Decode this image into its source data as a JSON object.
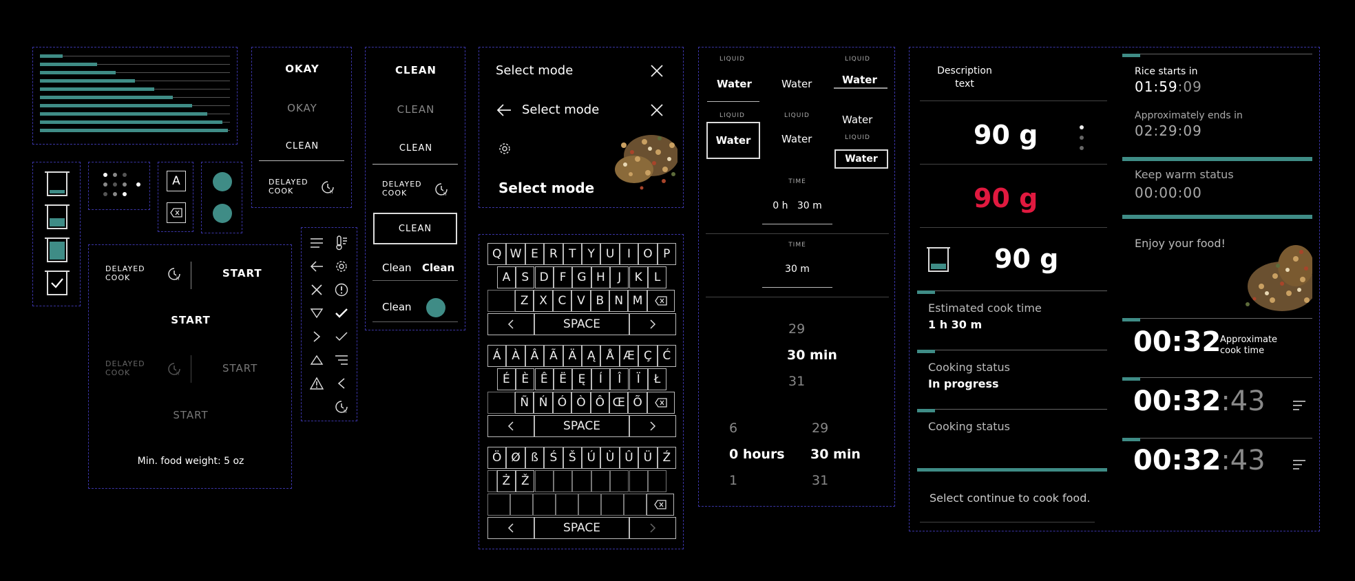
{
  "colors": {
    "background": "#000000",
    "accent": "#3f8c86",
    "alert": "#e0193f",
    "border": "#3b35a8"
  },
  "chart_bars": [
    0.12,
    0.3,
    0.4,
    0.5,
    0.6,
    0.7,
    0.8,
    0.88,
    0.96,
    0.99
  ],
  "buttons_col": {
    "okay_active": "OKAY",
    "okay_dim": "OKAY",
    "clean": "CLEAN",
    "delayed_line1": "DELAYED",
    "delayed_line2": "COOK"
  },
  "clean_col": {
    "clean_active": "CLEAN",
    "clean_dim": "CLEAN",
    "clean_plain": "CLEAN",
    "delayed_line1": "DELAYED",
    "delayed_line2": "COOK",
    "clean_boxed": "CLEAN",
    "clean_a": "Clean",
    "clean_b": "Clean",
    "clean_toggle": "Clean"
  },
  "letter_box": "A",
  "start_panel": {
    "delayed_line1": "DELAYED",
    "delayed_line2": "COOK",
    "start1": "START",
    "start2": "START",
    "start3": "START",
    "start4": "START",
    "min_weight": "Min. food weight: 5 oz"
  },
  "select_mode": {
    "title1": "Select mode",
    "title2": "Select mode",
    "title3": "Select mode"
  },
  "keyboard": {
    "row1": [
      "Q",
      "W",
      "E",
      "R",
      "T",
      "Y",
      "U",
      "I",
      "O",
      "P"
    ],
    "row2": [
      "A",
      "S",
      "D",
      "F",
      "G",
      "H",
      "J",
      "K",
      "L"
    ],
    "row3": [
      "Z",
      "X",
      "C",
      "V",
      "B",
      "N",
      "M"
    ],
    "space": "SPACE",
    "ext_row1": [
      "Á",
      "À",
      "Â",
      "Ã",
      "Ä",
      "Ą",
      "Å",
      "Æ",
      "Ç",
      "Ć"
    ],
    "ext_row2": [
      "É",
      "È",
      "Ê",
      "Ë",
      "Ę",
      "Í",
      "Î",
      "Ï",
      "Ł"
    ],
    "ext_row3": [
      "Ñ",
      "Ń",
      "Ó",
      "Ò",
      "Ô",
      "Œ",
      "Õ"
    ],
    "ext2_row1": [
      "Ö",
      "Ø",
      "ß",
      "Ś",
      "Š",
      "Ú",
      "Ù",
      "Û",
      "Ü",
      "Ź"
    ],
    "ext2_row2": [
      "Ż",
      "Ž"
    ]
  },
  "liquid": {
    "label": "LIQUID",
    "water": "Water",
    "time_label": "TIME",
    "time1": "0 h   30 m",
    "time2": "30 m",
    "picker1": {
      "prev": "29",
      "current": "30 min",
      "next": "31"
    },
    "picker2": {
      "h_prev": "6",
      "h_current": "0 hours",
      "h_next": "1",
      "m_prev": "29",
      "m_current": "30 min",
      "m_next": "31"
    }
  },
  "weight_panel": {
    "description": "Description text",
    "weight1": "90 g",
    "weight2": "90 g",
    "weight3": "90 g",
    "est_label": "Estimated cook time",
    "est_value": "1 h 30 m",
    "status_label": "Cooking status",
    "status_value": "In progress",
    "status_label2": "Cooking status",
    "continue": "Select continue to cook food."
  },
  "status_panel": {
    "rice_label": "Rice starts in",
    "rice_time": "01:59",
    "rice_secs": ":09",
    "ends_label": "Approximately ends in",
    "ends_time": "02:29:09",
    "warm_label": "Keep warm status",
    "warm_time": "00:00:00",
    "enjoy": "Enjoy your food!",
    "timer1": "00:32",
    "timer1_caption_l1": "Approximate",
    "timer1_caption_l2": "cook time",
    "timer2": "00:32",
    "timer2_secs": ":43",
    "timer3": "00:32",
    "timer3_secs": ":43"
  }
}
